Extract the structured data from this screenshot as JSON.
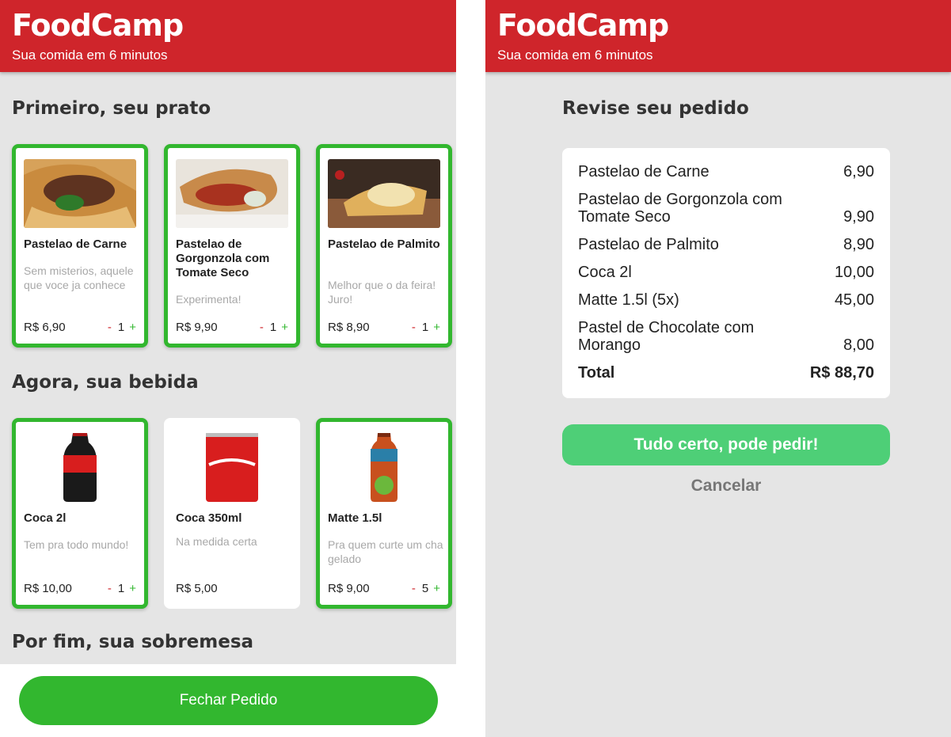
{
  "left": {
    "brand": "FoodCamp",
    "tagline": "Sua comida em 6 minutos",
    "sections": {
      "dishes": "Primeiro, seu prato",
      "drinks": "Agora, sua bebida",
      "desserts": "Por fim, sua sobremesa"
    },
    "dishes": [
      {
        "name": "Pastelao de Carne",
        "desc": "Sem misterios, aquele que voce ja conhece",
        "price": "R$ 6,90",
        "minus": "-",
        "qty": "1",
        "plus": "+",
        "selected": true
      },
      {
        "name": "Pastelao de Gorgonzola com Tomate Seco",
        "desc": "Experimenta!",
        "price": "R$ 9,90",
        "minus": "-",
        "qty": "1",
        "plus": "+",
        "selected": true
      },
      {
        "name": "Pastelao de Palmito",
        "desc": "Melhor que o da feira! Juro!",
        "price": "R$ 8,90",
        "minus": "-",
        "qty": "1",
        "plus": "+",
        "selected": true
      }
    ],
    "drinks": [
      {
        "name": "Coca 2l",
        "desc": "Tem pra todo mundo!",
        "price": "R$ 10,00",
        "minus": "-",
        "qty": "1",
        "plus": "+",
        "selected": true
      },
      {
        "name": "Coca 350ml",
        "desc": "Na medida certa",
        "price": "R$ 5,00",
        "selected": false
      },
      {
        "name": "Matte 1.5l",
        "desc": "Pra quem curte um cha gelado",
        "price": "R$ 9,00",
        "minus": "-",
        "qty": "5",
        "plus": "+",
        "selected": true
      }
    ],
    "close_button": "Fechar Pedido"
  },
  "right": {
    "brand": "FoodCamp",
    "tagline": "Sua comida em 6 minutos",
    "title": "Revise seu pedido",
    "items": [
      {
        "name": "Pastelao de Carne",
        "price": "6,90"
      },
      {
        "name": "Pastelao de Gorgonzola com Tomate Seco",
        "price": "9,90"
      },
      {
        "name": "Pastelao de Palmito",
        "price": "8,90"
      },
      {
        "name": "Coca 2l",
        "price": "10,00"
      },
      {
        "name": "Matte 1.5l (5x)",
        "price": "45,00"
      },
      {
        "name": "Pastel de Chocolate com Morango",
        "price": "8,00"
      }
    ],
    "total_label": "Total",
    "total_value": "R$ 88,70",
    "confirm_button": "Tudo certo, pode pedir!",
    "cancel_button": "Cancelar"
  },
  "colors": {
    "brand_red": "#cf252b",
    "select_green": "#32b72f",
    "confirm_green": "#4ecf77",
    "background": "#e5e5e5"
  }
}
